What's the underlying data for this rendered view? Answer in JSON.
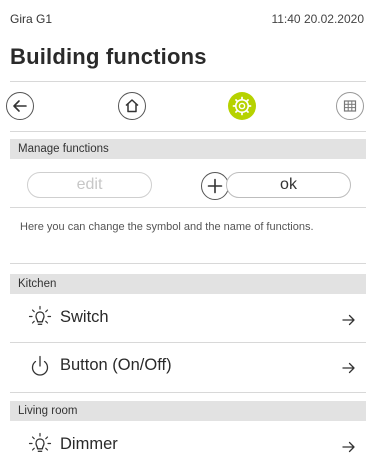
{
  "status": {
    "app_name": "Gira G1",
    "datetime": "11:40 20.02.2020"
  },
  "page": {
    "title": "Building functions"
  },
  "nav": {
    "back_icon": "arrow-left-icon",
    "home_icon": "home-icon",
    "settings_icon": "gear-icon",
    "grid_icon": "grid-icon",
    "active_color": "#b6d200"
  },
  "manage": {
    "header": "Manage functions",
    "edit_label": "edit",
    "ok_label": "ok",
    "add_icon": "plus-icon",
    "info": "Here you can change the symbol and the name of functions."
  },
  "rooms": [
    {
      "name": "Kitchen",
      "functions": [
        {
          "label": "Switch",
          "icon": "light-bulb-icon"
        },
        {
          "label": "Button (On/Off)",
          "icon": "power-icon"
        }
      ]
    },
    {
      "name": "Living room",
      "functions": [
        {
          "label": "Dimmer",
          "icon": "light-bulb-icon"
        }
      ]
    }
  ]
}
